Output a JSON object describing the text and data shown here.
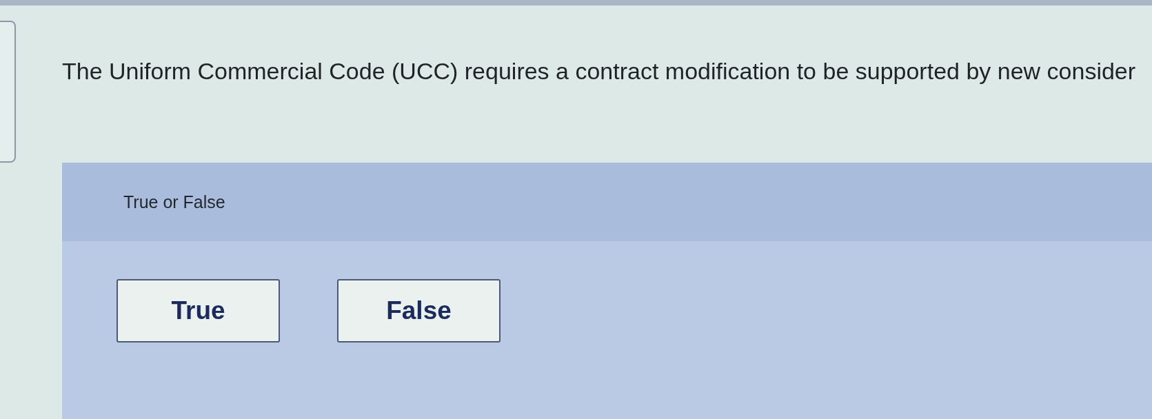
{
  "question": {
    "text": "The Uniform Commercial Code (UCC) requires a contract modification to be supported by new consider"
  },
  "answer_panel": {
    "prompt": "True or False",
    "options": [
      {
        "label": "True",
        "selected": false
      },
      {
        "label": "False",
        "selected": false
      }
    ]
  }
}
